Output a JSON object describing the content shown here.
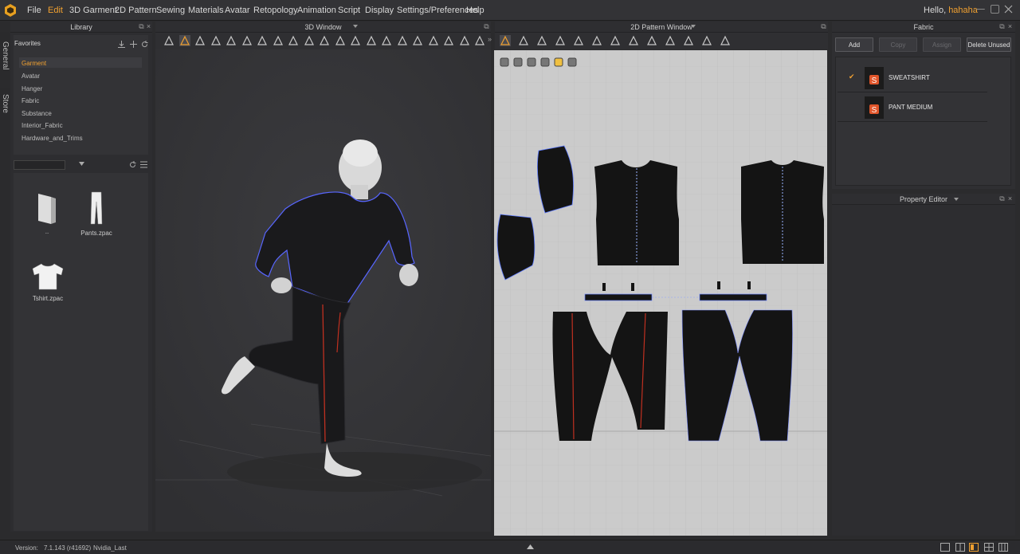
{
  "menu": {
    "items": [
      "File",
      "Edit",
      "3D Garment",
      "2D Pattern",
      "Sewing",
      "Materials",
      "Avatar",
      "Retopology",
      "Animation",
      "Script",
      "Display",
      "Settings/Preferences",
      "Help"
    ],
    "active": "Edit",
    "greeting": "Hello,",
    "username": "hahaha"
  },
  "side_tabs": [
    "General",
    "Store"
  ],
  "library": {
    "title": "Library",
    "favorites_label": "Favorites",
    "categories": [
      "Garment",
      "Avatar",
      "Hanger",
      "Fabric",
      "Substance",
      "Interior_Fabric",
      "Hardware_and_Trims"
    ],
    "selected": "Garment",
    "search_value": "",
    "files": [
      {
        "name": "..",
        "icon": "folder-up-icon"
      },
      {
        "name": "Pants.zpac",
        "icon": "pants-icon"
      },
      {
        "name": "Tshirt.zpac",
        "icon": "tshirt-icon"
      }
    ]
  },
  "window3d": {
    "title": "3D Window"
  },
  "window2d": {
    "title": "2D Pattern Window"
  },
  "fabric": {
    "title": "Fabric",
    "buttons": {
      "add": "Add",
      "copy": "Copy",
      "assign": "Assign",
      "delete_unused": "Delete Unused"
    },
    "items": [
      {
        "name": "SWEATSHIRT",
        "checked": true
      },
      {
        "name": "PANT MEDIUM",
        "checked": false
      }
    ],
    "check_glyph": "✔"
  },
  "property_editor": {
    "title": "Property Editor"
  },
  "status": {
    "version_label": "Version:",
    "version": "7.1.143 (r41692)",
    "renderer": "Nvidia_Last"
  },
  "colors": {
    "accent": "#f0a030",
    "panel": "#313134",
    "viewport": "#353538",
    "pattern_bg": "#cbcbcb",
    "stitch": "#c03020"
  }
}
